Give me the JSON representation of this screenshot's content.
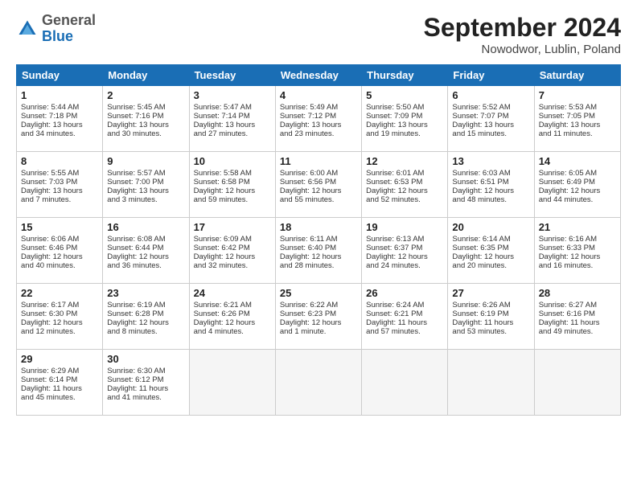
{
  "header": {
    "logo_general": "General",
    "logo_blue": "Blue",
    "month_title": "September 2024",
    "location": "Nowodwor, Lublin, Poland"
  },
  "days_of_week": [
    "Sunday",
    "Monday",
    "Tuesday",
    "Wednesday",
    "Thursday",
    "Friday",
    "Saturday"
  ],
  "weeks": [
    [
      {
        "day": "1",
        "lines": [
          "Sunrise: 5:44 AM",
          "Sunset: 7:18 PM",
          "Daylight: 13 hours",
          "and 34 minutes."
        ]
      },
      {
        "day": "2",
        "lines": [
          "Sunrise: 5:45 AM",
          "Sunset: 7:16 PM",
          "Daylight: 13 hours",
          "and 30 minutes."
        ]
      },
      {
        "day": "3",
        "lines": [
          "Sunrise: 5:47 AM",
          "Sunset: 7:14 PM",
          "Daylight: 13 hours",
          "and 27 minutes."
        ]
      },
      {
        "day": "4",
        "lines": [
          "Sunrise: 5:49 AM",
          "Sunset: 7:12 PM",
          "Daylight: 13 hours",
          "and 23 minutes."
        ]
      },
      {
        "day": "5",
        "lines": [
          "Sunrise: 5:50 AM",
          "Sunset: 7:09 PM",
          "Daylight: 13 hours",
          "and 19 minutes."
        ]
      },
      {
        "day": "6",
        "lines": [
          "Sunrise: 5:52 AM",
          "Sunset: 7:07 PM",
          "Daylight: 13 hours",
          "and 15 minutes."
        ]
      },
      {
        "day": "7",
        "lines": [
          "Sunrise: 5:53 AM",
          "Sunset: 7:05 PM",
          "Daylight: 13 hours",
          "and 11 minutes."
        ]
      }
    ],
    [
      {
        "day": "8",
        "lines": [
          "Sunrise: 5:55 AM",
          "Sunset: 7:03 PM",
          "Daylight: 13 hours",
          "and 7 minutes."
        ]
      },
      {
        "day": "9",
        "lines": [
          "Sunrise: 5:57 AM",
          "Sunset: 7:00 PM",
          "Daylight: 13 hours",
          "and 3 minutes."
        ]
      },
      {
        "day": "10",
        "lines": [
          "Sunrise: 5:58 AM",
          "Sunset: 6:58 PM",
          "Daylight: 12 hours",
          "and 59 minutes."
        ]
      },
      {
        "day": "11",
        "lines": [
          "Sunrise: 6:00 AM",
          "Sunset: 6:56 PM",
          "Daylight: 12 hours",
          "and 55 minutes."
        ]
      },
      {
        "day": "12",
        "lines": [
          "Sunrise: 6:01 AM",
          "Sunset: 6:53 PM",
          "Daylight: 12 hours",
          "and 52 minutes."
        ]
      },
      {
        "day": "13",
        "lines": [
          "Sunrise: 6:03 AM",
          "Sunset: 6:51 PM",
          "Daylight: 12 hours",
          "and 48 minutes."
        ]
      },
      {
        "day": "14",
        "lines": [
          "Sunrise: 6:05 AM",
          "Sunset: 6:49 PM",
          "Daylight: 12 hours",
          "and 44 minutes."
        ]
      }
    ],
    [
      {
        "day": "15",
        "lines": [
          "Sunrise: 6:06 AM",
          "Sunset: 6:46 PM",
          "Daylight: 12 hours",
          "and 40 minutes."
        ]
      },
      {
        "day": "16",
        "lines": [
          "Sunrise: 6:08 AM",
          "Sunset: 6:44 PM",
          "Daylight: 12 hours",
          "and 36 minutes."
        ]
      },
      {
        "day": "17",
        "lines": [
          "Sunrise: 6:09 AM",
          "Sunset: 6:42 PM",
          "Daylight: 12 hours",
          "and 32 minutes."
        ]
      },
      {
        "day": "18",
        "lines": [
          "Sunrise: 6:11 AM",
          "Sunset: 6:40 PM",
          "Daylight: 12 hours",
          "and 28 minutes."
        ]
      },
      {
        "day": "19",
        "lines": [
          "Sunrise: 6:13 AM",
          "Sunset: 6:37 PM",
          "Daylight: 12 hours",
          "and 24 minutes."
        ]
      },
      {
        "day": "20",
        "lines": [
          "Sunrise: 6:14 AM",
          "Sunset: 6:35 PM",
          "Daylight: 12 hours",
          "and 20 minutes."
        ]
      },
      {
        "day": "21",
        "lines": [
          "Sunrise: 6:16 AM",
          "Sunset: 6:33 PM",
          "Daylight: 12 hours",
          "and 16 minutes."
        ]
      }
    ],
    [
      {
        "day": "22",
        "lines": [
          "Sunrise: 6:17 AM",
          "Sunset: 6:30 PM",
          "Daylight: 12 hours",
          "and 12 minutes."
        ]
      },
      {
        "day": "23",
        "lines": [
          "Sunrise: 6:19 AM",
          "Sunset: 6:28 PM",
          "Daylight: 12 hours",
          "and 8 minutes."
        ]
      },
      {
        "day": "24",
        "lines": [
          "Sunrise: 6:21 AM",
          "Sunset: 6:26 PM",
          "Daylight: 12 hours",
          "and 4 minutes."
        ]
      },
      {
        "day": "25",
        "lines": [
          "Sunrise: 6:22 AM",
          "Sunset: 6:23 PM",
          "Daylight: 12 hours",
          "and 1 minute."
        ]
      },
      {
        "day": "26",
        "lines": [
          "Sunrise: 6:24 AM",
          "Sunset: 6:21 PM",
          "Daylight: 11 hours",
          "and 57 minutes."
        ]
      },
      {
        "day": "27",
        "lines": [
          "Sunrise: 6:26 AM",
          "Sunset: 6:19 PM",
          "Daylight: 11 hours",
          "and 53 minutes."
        ]
      },
      {
        "day": "28",
        "lines": [
          "Sunrise: 6:27 AM",
          "Sunset: 6:16 PM",
          "Daylight: 11 hours",
          "and 49 minutes."
        ]
      }
    ],
    [
      {
        "day": "29",
        "lines": [
          "Sunrise: 6:29 AM",
          "Sunset: 6:14 PM",
          "Daylight: 11 hours",
          "and 45 minutes."
        ]
      },
      {
        "day": "30",
        "lines": [
          "Sunrise: 6:30 AM",
          "Sunset: 6:12 PM",
          "Daylight: 11 hours",
          "and 41 minutes."
        ]
      },
      {
        "day": "",
        "lines": []
      },
      {
        "day": "",
        "lines": []
      },
      {
        "day": "",
        "lines": []
      },
      {
        "day": "",
        "lines": []
      },
      {
        "day": "",
        "lines": []
      }
    ]
  ]
}
